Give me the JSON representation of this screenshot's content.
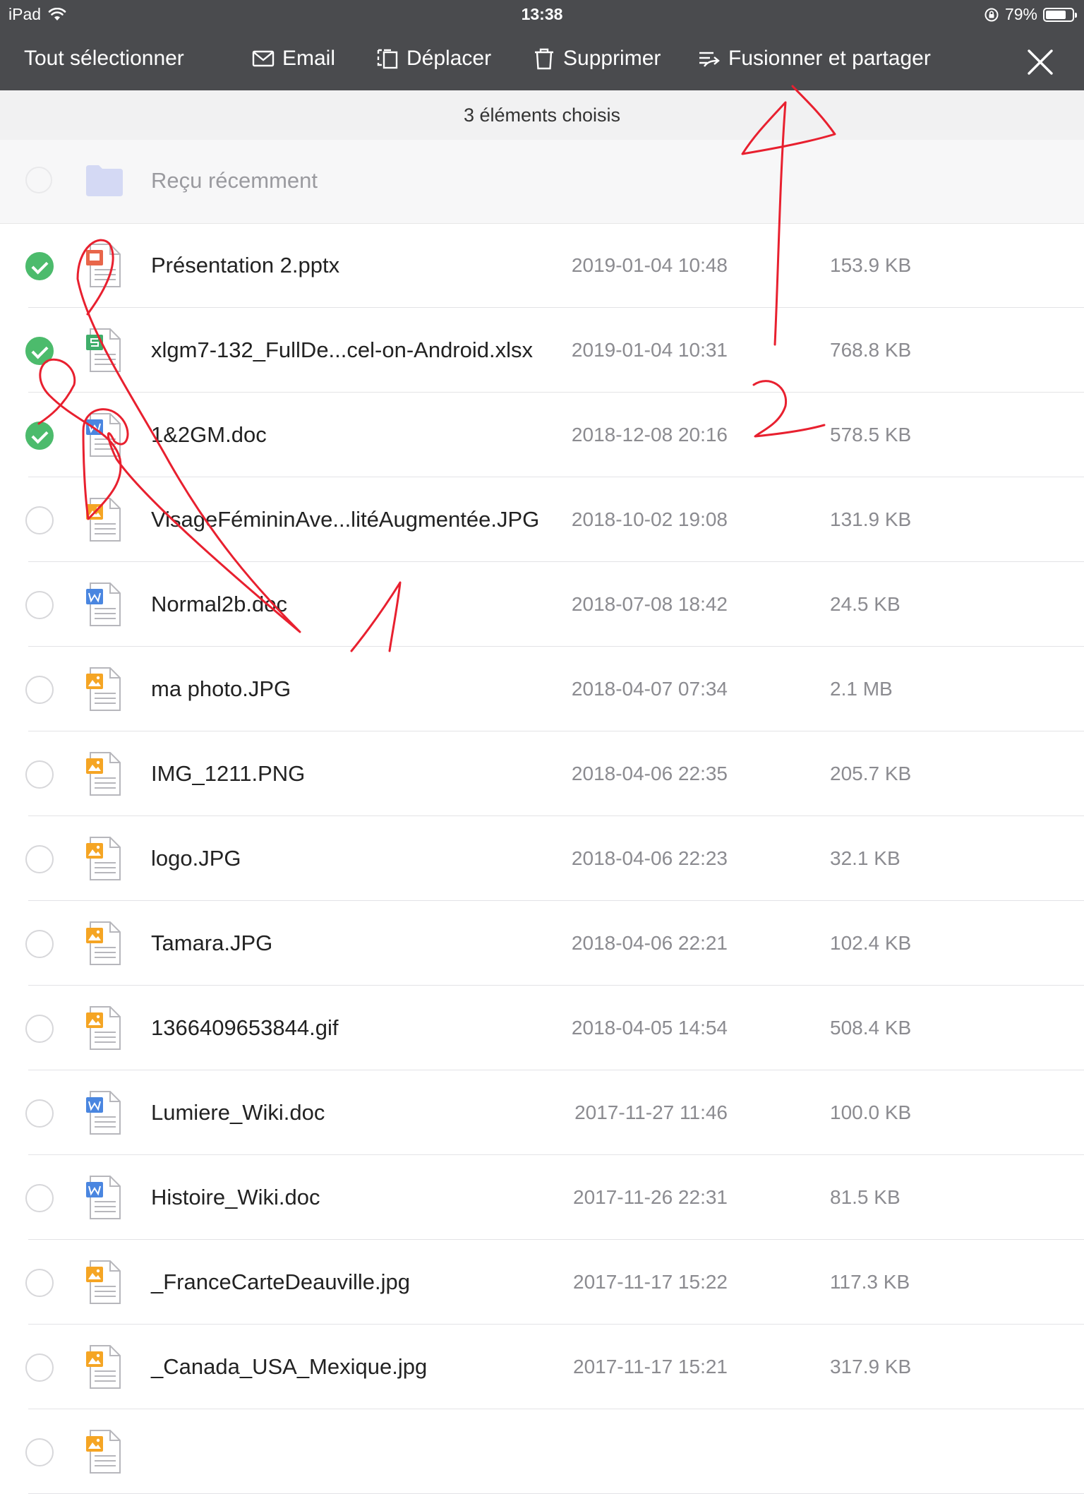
{
  "status_bar": {
    "device": "iPad",
    "time": "13:38",
    "battery_percent": "79%",
    "battery_level": 0.79
  },
  "toolbar": {
    "select_all": "Tout sélectionner",
    "email": "Email",
    "move": "Déplacer",
    "delete": "Supprimer",
    "merge_share": "Fusionner et partager"
  },
  "subheader": {
    "selection_count": "3 éléments choisis"
  },
  "recent_folder": {
    "label": "Reçu récemment"
  },
  "files": [
    {
      "name": "Présentation 2.pptx",
      "date": "2019-01-04 10:48",
      "size": "153.9 KB",
      "type": "ppt",
      "selected": true
    },
    {
      "name": "xlgm7-132_FullDe...cel-on-Android.xlsx",
      "date": "2019-01-04 10:31",
      "size": "768.8 KB",
      "type": "xls",
      "selected": true
    },
    {
      "name": "1&2GM.doc",
      "date": "2018-12-08 20:16",
      "size": "578.5 KB",
      "type": "doc",
      "selected": true
    },
    {
      "name": "VisageFémininAve...litéAugmentée.JPG",
      "date": "2018-10-02 19:08",
      "size": "131.9 KB",
      "type": "img",
      "selected": false
    },
    {
      "name": "Normal2b.doc",
      "date": "2018-07-08 18:42",
      "size": "24.5 KB",
      "type": "doc",
      "selected": false
    },
    {
      "name": "ma photo.JPG",
      "date": "2018-04-07 07:34",
      "size": "2.1 MB",
      "type": "img",
      "selected": false
    },
    {
      "name": "IMG_1211.PNG",
      "date": "2018-04-06 22:35",
      "size": "205.7 KB",
      "type": "img",
      "selected": false
    },
    {
      "name": "logo.JPG",
      "date": "2018-04-06 22:23",
      "size": "32.1 KB",
      "type": "img",
      "selected": false
    },
    {
      "name": "Tamara.JPG",
      "date": "2018-04-06 22:21",
      "size": "102.4 KB",
      "type": "img",
      "selected": false
    },
    {
      "name": "1366409653844.gif",
      "date": "2018-04-05 14:54",
      "size": "508.4 KB",
      "type": "img",
      "selected": false
    },
    {
      "name": "Lumiere_Wiki.doc",
      "date": "2017-11-27 11:46",
      "size": "100.0 KB",
      "type": "doc",
      "selected": false
    },
    {
      "name": "Histoire_Wiki.doc",
      "date": "2017-11-26 22:31",
      "size": "81.5 KB",
      "type": "doc",
      "selected": false
    },
    {
      "name": "_FranceCarteDeauville.jpg",
      "date": "2017-11-17 15:22",
      "size": "117.3 KB",
      "type": "img",
      "selected": false
    },
    {
      "name": "_Canada_USA_Mexique.jpg",
      "date": "2017-11-17 15:21",
      "size": "317.9 KB",
      "type": "img",
      "selected": false
    },
    {
      "name": "",
      "date": "",
      "size": "",
      "type": "img",
      "selected": false
    }
  ],
  "colors": {
    "toolbar_bg": "#4a4b4e",
    "check_green": "#4cbb6c",
    "ppt": "#e8664a",
    "xls": "#3fae6a",
    "doc": "#4a86e0",
    "img": "#f5a524",
    "annotation_red": "#e8202f"
  },
  "annotations": {
    "step1": "1",
    "step2": "2"
  }
}
